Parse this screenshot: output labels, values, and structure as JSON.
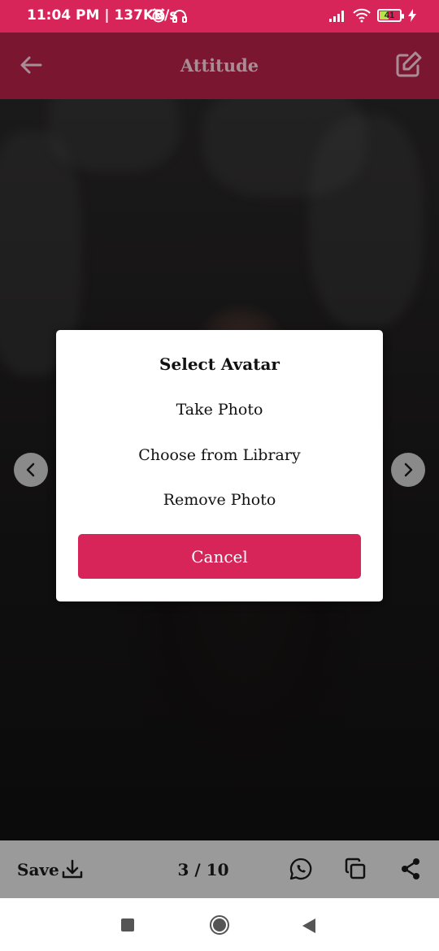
{
  "status_bar": {
    "time_speed": "11:04 PM | 137KB/s",
    "battery": "41",
    "icons": [
      "alarm-icon",
      "headphones-icon",
      "signal-icon",
      "wifi-icon",
      "battery-icon",
      "charging-icon"
    ]
  },
  "app_bar": {
    "title": "Attitude",
    "back_icon": "arrow-left-icon",
    "edit_icon": "edit-icon"
  },
  "dialog": {
    "title": "Select Avatar",
    "options": [
      "Take Photo",
      "Choose from Library",
      "Remove Photo"
    ],
    "cancel_label": "Cancel"
  },
  "bottom_bar": {
    "save_label": "Save",
    "counter": "3 / 10",
    "icons": [
      "download-icon",
      "whatsapp-icon",
      "copy-icon",
      "share-icon"
    ]
  },
  "colors": {
    "accent": "#d7255a",
    "app_bar": "#7a1630",
    "bottom_bar": "#9a9a9a"
  }
}
